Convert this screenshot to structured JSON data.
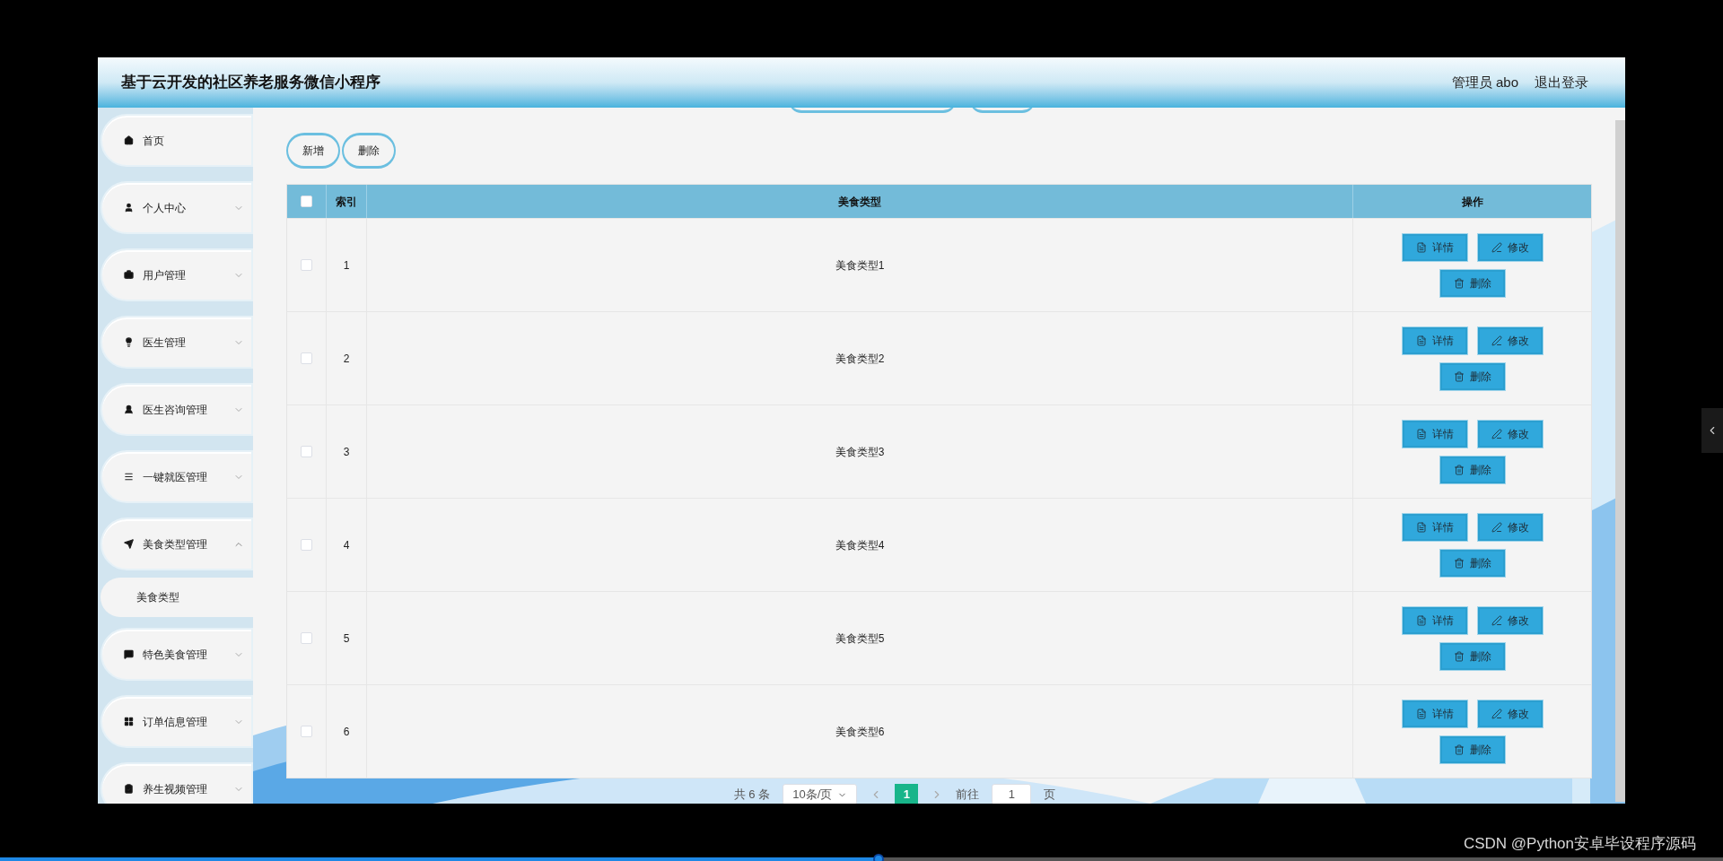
{
  "header": {
    "title": "基于云开发的社区养老服务微信小程序",
    "user": "管理员 abo",
    "logout": "退出登录"
  },
  "sidebar": {
    "items": [
      {
        "label": "首页",
        "kind": "link"
      },
      {
        "label": "个人中心",
        "kind": "menu",
        "expanded": false
      },
      {
        "label": "用户管理",
        "kind": "menu",
        "expanded": false
      },
      {
        "label": "医生管理",
        "kind": "menu",
        "expanded": false
      },
      {
        "label": "医生咨询管理",
        "kind": "menu",
        "expanded": false
      },
      {
        "label": "一键就医管理",
        "kind": "menu",
        "expanded": false
      },
      {
        "label": "美食类型管理",
        "kind": "menu",
        "expanded": true,
        "children": [
          {
            "label": "美食类型"
          }
        ]
      },
      {
        "label": "特色美食管理",
        "kind": "menu",
        "expanded": false
      },
      {
        "label": "订单信息管理",
        "kind": "menu",
        "expanded": false
      },
      {
        "label": "养生视频管理",
        "kind": "menu",
        "expanded": false
      }
    ]
  },
  "toolbar": {
    "buttons": [
      "新增",
      "删除"
    ]
  },
  "table": {
    "select_all": {
      "checked": false
    },
    "columns": [
      "索引",
      "美食类型",
      "操作"
    ],
    "rows": [
      {
        "index": "1",
        "type": "美食类型1",
        "selected": false,
        "actions": [
          "详情",
          "修改",
          "删除"
        ]
      },
      {
        "index": "2",
        "type": "美食类型2",
        "selected": false,
        "actions": [
          "详情",
          "修改",
          "删除"
        ]
      },
      {
        "index": "3",
        "type": "美食类型3",
        "selected": false,
        "actions": [
          "详情",
          "修改",
          "删除"
        ]
      },
      {
        "index": "4",
        "type": "美食类型4",
        "selected": false,
        "actions": [
          "详情",
          "修改",
          "删除"
        ]
      },
      {
        "index": "5",
        "type": "美食类型5",
        "selected": false,
        "actions": [
          "详情",
          "修改",
          "删除"
        ]
      },
      {
        "index": "6",
        "type": "美食类型6",
        "selected": false,
        "actions": [
          "详情",
          "修改",
          "删除"
        ]
      }
    ]
  },
  "pagination": {
    "total": "共 6 条",
    "page_size": "10条/页",
    "pages": [
      {
        "label": "1",
        "selected": true
      }
    ],
    "goto_label": "前往",
    "goto_value": "1",
    "goto_suffix": "页"
  },
  "player": {
    "caption": "CSDN @Python安卓毕设程序源码",
    "progress": {
      "level": 0.51
    }
  }
}
